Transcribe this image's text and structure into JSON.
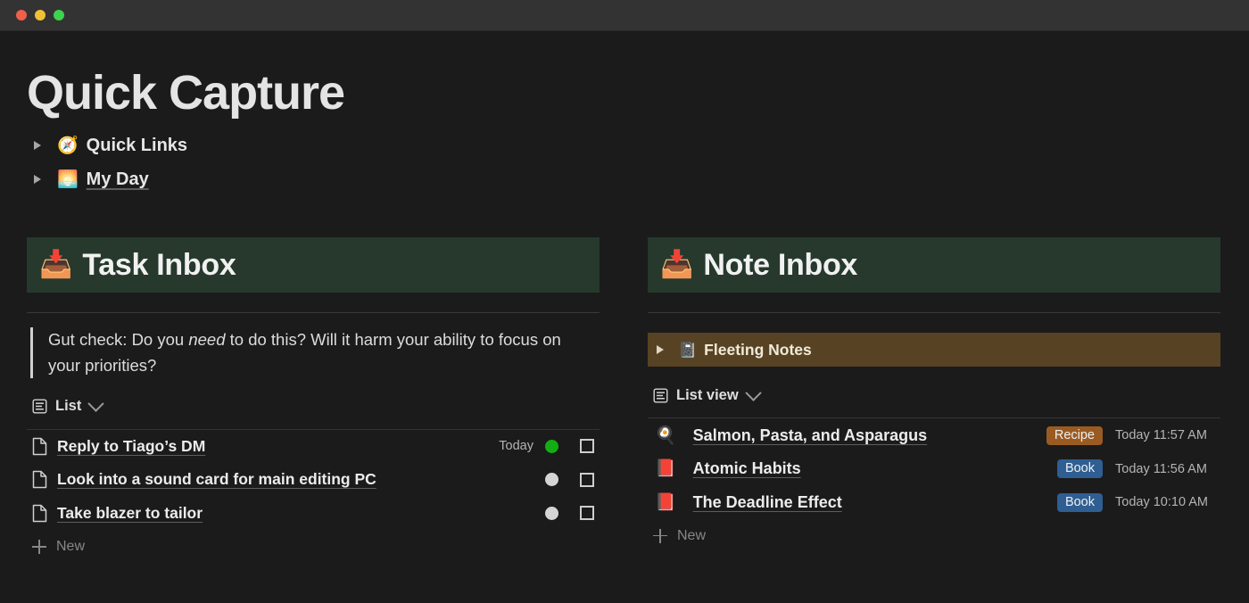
{
  "window": {
    "traffic_lights": [
      {
        "name": "close",
        "color": "#ef5f4a"
      },
      {
        "name": "minimize",
        "color": "#f0c037"
      },
      {
        "name": "maximize",
        "color": "#3fd24f"
      }
    ]
  },
  "page": {
    "title": "Quick Capture"
  },
  "collapsibles": [
    {
      "icon": "compass-emoji",
      "glyph": "🧭",
      "label": "Quick Links",
      "expanded": false,
      "underline": false
    },
    {
      "icon": "sunrise-emoji",
      "glyph": "🌅",
      "label": "My Day",
      "expanded": false,
      "underline": true
    }
  ],
  "task_inbox": {
    "header": {
      "icon": "inbox-tray-emoji",
      "glyph": "📥",
      "title": "Task Inbox",
      "background": "#26392c"
    },
    "callout": {
      "prefix": "Gut check: Do you ",
      "emphasis": "need",
      "suffix": " to do this? Will it harm your ability to focus on your priorities?"
    },
    "view": {
      "icon": "list-view-icon",
      "label": "List",
      "chevron": "chevron-down-icon"
    },
    "columns": [
      "name",
      "due",
      "status",
      "done"
    ],
    "rows": [
      {
        "icon": "page-icon",
        "name": "Reply to Tiago’s DM",
        "due": "Today",
        "status_color": "#13ad13",
        "done": false
      },
      {
        "icon": "page-icon",
        "name": "Look into a sound card for main editing PC",
        "due": "",
        "status_color": "#d5d5d5",
        "done": false
      },
      {
        "icon": "page-icon",
        "name": "Take blazer to tailor",
        "due": "",
        "status_color": "#d5d5d5",
        "done": false
      }
    ],
    "new_label": "New"
  },
  "note_inbox": {
    "header": {
      "icon": "inbox-tray-emoji",
      "glyph": "📥",
      "title": "Note Inbox",
      "background": "#26392c"
    },
    "fleeting": {
      "icon": "pages-emoji",
      "glyph": "📓",
      "label": "Fleeting Notes",
      "background": "#574323",
      "expanded": false
    },
    "view": {
      "icon": "list-view-icon",
      "label": "List view",
      "chevron": "chevron-down-icon"
    },
    "columns": [
      "name",
      "tag",
      "time"
    ],
    "rows": [
      {
        "icon": "cooking-emoji",
        "glyph": "🍳",
        "name": "Salmon, Pasta, and Asparagus",
        "tag": "Recipe",
        "tag_color": "#9a5b23",
        "time": "Today 11:57 AM"
      },
      {
        "icon": "closed-book-emoji",
        "glyph": "📕",
        "name": "Atomic Habits",
        "tag": "Book",
        "tag_color": "#2f5e92",
        "time": "Today 11:56 AM"
      },
      {
        "icon": "closed-book-emoji",
        "glyph": "📕",
        "name": "The Deadline Effect",
        "tag": "Book",
        "tag_color": "#2f5e92",
        "time": "Today 10:10 AM"
      }
    ],
    "new_label": "New"
  }
}
